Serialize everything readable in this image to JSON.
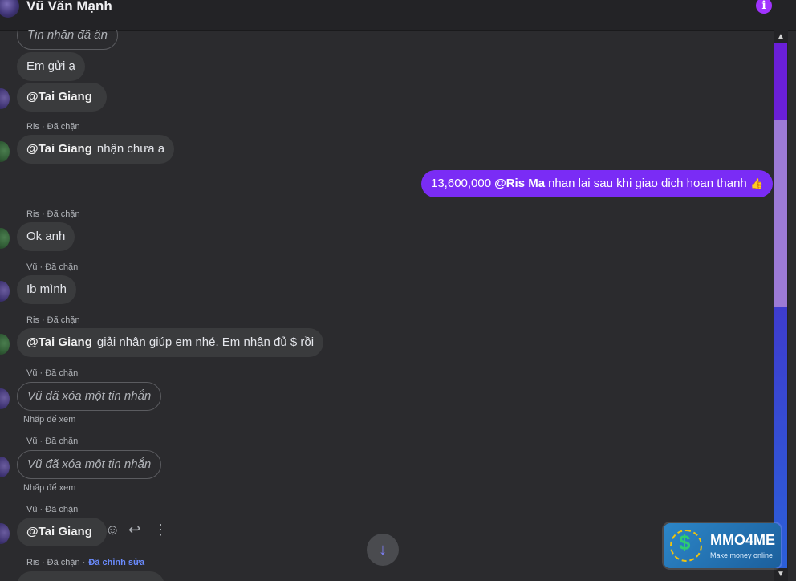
{
  "header": {
    "title": "Vũ Văn Mạnh",
    "info_icon": "i"
  },
  "messages": [
    {
      "text": "Tin nhắn đã ẩn"
    },
    {
      "text": "Em gửi ạ"
    },
    {
      "mention": "@Tai Giang"
    },
    {
      "sender": "Ris · Đã chặn",
      "mention": "@Tai Giang",
      "text": "nhận chưa a"
    },
    {
      "amount": "13,600,000",
      "mention": "@Ris Ma",
      "text": "nhan lai sau khi giao dich hoan thanh",
      "emoji": "👍"
    },
    {
      "sender": "Ris · Đã chặn",
      "text": "Ok anh"
    },
    {
      "sender": "Vũ · Đã chặn",
      "text": "Ib mình"
    },
    {
      "sender": "Ris · Đã chặn",
      "mention": "@Tai Giang",
      "text": "giải nhân giúp em nhé. Em nhận đủ $ rồi"
    },
    {
      "sender": "Vũ · Đã chặn",
      "text": "Vũ đã xóa một tin nhắn",
      "note": "Nhấp để xem"
    },
    {
      "sender": "Vũ · Đã chặn",
      "text": "Vũ đã xóa một tin nhắn",
      "note": "Nhấp để xem"
    },
    {
      "sender": "Vũ · Đã chặn",
      "mention": "@Tai Giang"
    },
    {
      "sender": "Ris · Đã chặn ·",
      "edited": "Đã chỉnh sửa"
    }
  ],
  "actions": {
    "react": "☺",
    "reply": "↩",
    "more": "⋮"
  },
  "scroll_down": "↓",
  "scrollbar": {
    "up": "▲",
    "down": "▼"
  },
  "logo": {
    "name": "MMO4ME",
    "tagline": "Make money online",
    "symbol": "$"
  },
  "colors": {
    "accent": "#7a2cf5",
    "info": "#a033ff",
    "bubble": "#3a3b3d",
    "background": "#2b2b2e"
  }
}
